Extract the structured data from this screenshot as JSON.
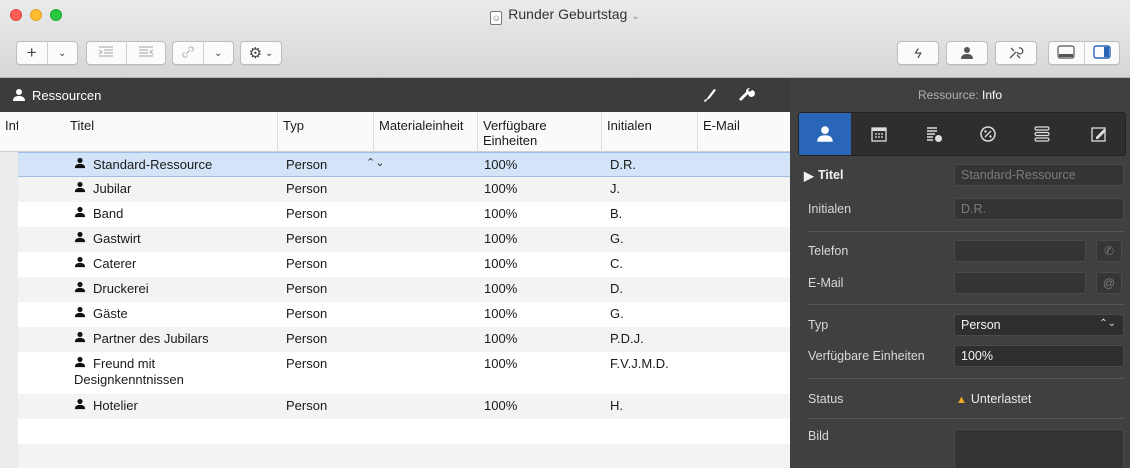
{
  "window": {
    "title": "Runder Geburtstag"
  },
  "toolbar": {
    "add_label": "+",
    "gear_label": "⚙"
  },
  "resources_header": {
    "label": "Ressourcen"
  },
  "table": {
    "columns": [
      "Info",
      "Titel",
      "Typ",
      "Materialeinheit",
      "Verfügbare Einheiten",
      "Initialen",
      "E-Mail"
    ],
    "rows": [
      {
        "titel": "Standard-Ressource",
        "typ": "Person",
        "verfuegbar": "100%",
        "initialen": "D.R.",
        "selected": true
      },
      {
        "titel": "Jubilar",
        "typ": "Person",
        "verfuegbar": "100%",
        "initialen": "J."
      },
      {
        "titel": "Band",
        "typ": "Person",
        "verfuegbar": "100%",
        "initialen": "B."
      },
      {
        "titel": "Gastwirt",
        "typ": "Person",
        "verfuegbar": "100%",
        "initialen": "G."
      },
      {
        "titel": "Caterer",
        "typ": "Person",
        "verfuegbar": "100%",
        "initialen": "C."
      },
      {
        "titel": "Druckerei",
        "typ": "Person",
        "verfuegbar": "100%",
        "initialen": "D."
      },
      {
        "titel": "Gäste",
        "typ": "Person",
        "verfuegbar": "100%",
        "initialen": "G."
      },
      {
        "titel": "Partner des Jubilars",
        "typ": "Person",
        "verfuegbar": "100%",
        "initialen": "P.D.J."
      },
      {
        "titel_line1": "Freund mit",
        "titel_line2": "Designkenntnissen",
        "typ": "Person",
        "verfuegbar": "100%",
        "initialen": "F.V.J.M.D."
      },
      {
        "titel": "Hotelier",
        "typ": "Person",
        "verfuegbar": "100%",
        "initialen": "H."
      }
    ]
  },
  "inspector": {
    "title_prefix": "Ressource:",
    "title_section": "Info",
    "titel_label": "Titel",
    "titel_value": "Standard-Ressource",
    "initialen_label": "Initialen",
    "initialen_value": "D.R.",
    "telefon_label": "Telefon",
    "email_label": "E-Mail",
    "typ_label": "Typ",
    "typ_value": "Person",
    "einheiten_label": "Verfügbare Einheiten",
    "einheiten_value": "100%",
    "status_label": "Status",
    "status_value": "Unterlastet",
    "bild_label": "Bild"
  },
  "colors": {
    "accent": "#2a66b8",
    "selection": "#d3e4f8",
    "status_warning": "#f5a623",
    "dark_panel": "#404040"
  }
}
